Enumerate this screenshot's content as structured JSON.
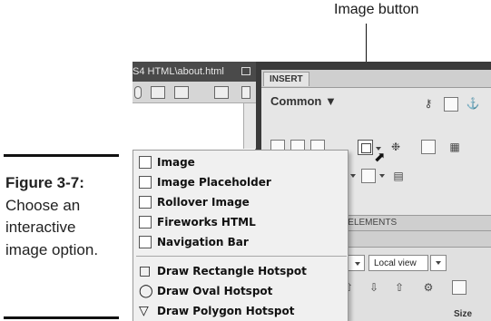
{
  "callout": {
    "label": "Image button"
  },
  "caption": {
    "figure": "Figure 3-7",
    "text": "Choose an interactive image option."
  },
  "document": {
    "tab_title": "S4 HTML\\about.html"
  },
  "insert_panel": {
    "tab": "INSERT",
    "category": "Common"
  },
  "tag_panel": {
    "tab": "P ELEMENTS"
  },
  "files_panel": {
    "view_select": "Local view",
    "size_column": "Size"
  },
  "menu": {
    "items": [
      {
        "label": "Image",
        "icon": "image-icon"
      },
      {
        "label": "Image Placeholder",
        "icon": "image-placeholder-icon"
      },
      {
        "label": "Rollover Image",
        "icon": "rollover-image-icon"
      },
      {
        "label": "Fireworks HTML",
        "icon": "fireworks-html-icon"
      },
      {
        "label": "Navigation Bar",
        "icon": "navigation-bar-icon"
      },
      {
        "label": "Draw Rectangle Hotspot",
        "icon": "rectangle-hotspot-icon"
      },
      {
        "label": "Draw Oval Hotspot",
        "icon": "oval-hotspot-icon"
      },
      {
        "label": "Draw Polygon Hotspot",
        "icon": "polygon-hotspot-icon"
      }
    ]
  }
}
